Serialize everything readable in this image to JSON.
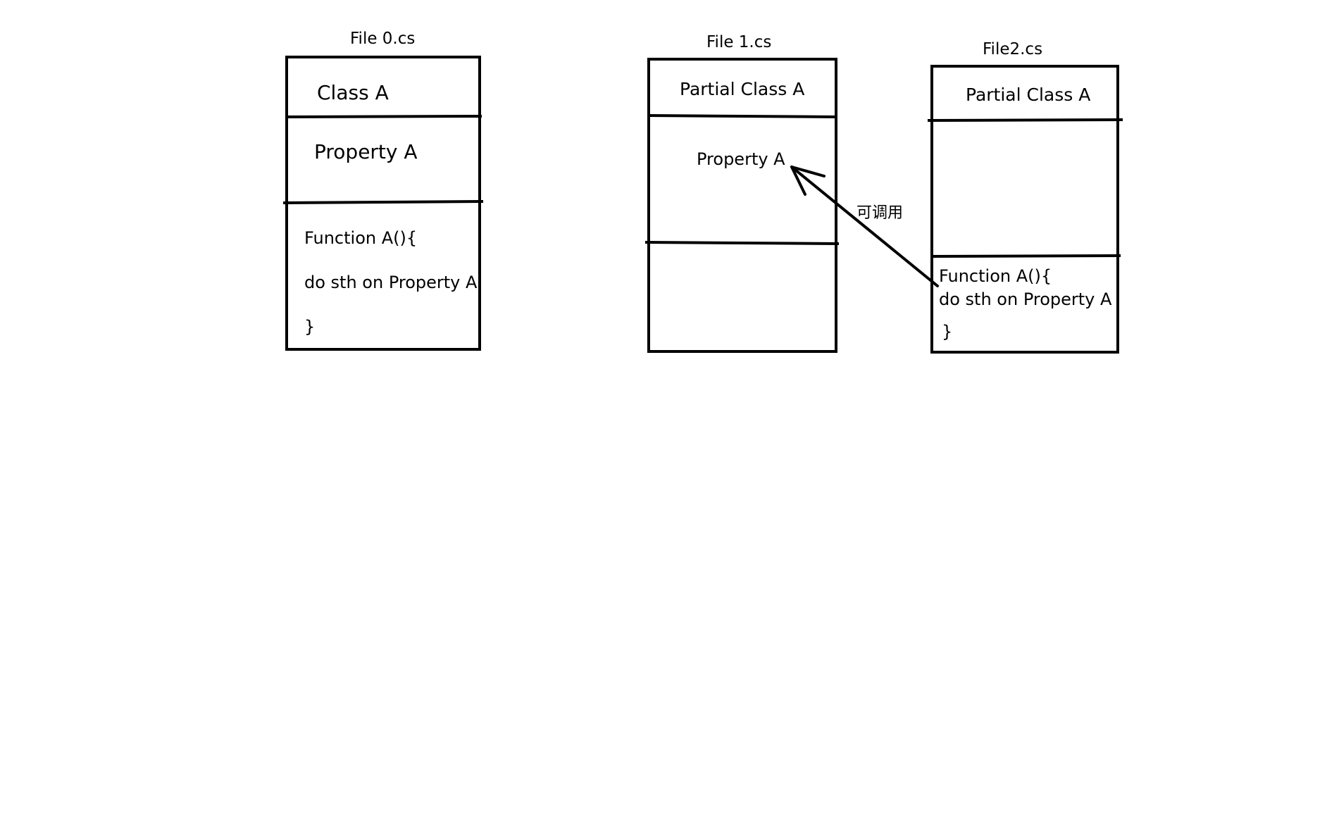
{
  "diagram": {
    "colors": {
      "stroke": "#000000",
      "background": "#ffffff",
      "text": "#000000"
    },
    "files": [
      {
        "label": "File 0.cs",
        "header": "Class A",
        "property": "Property A",
        "function_lines": [
          "Function A(){",
          "do sth on Property A",
          "}"
        ]
      },
      {
        "label": "File 1.cs",
        "header": "Partial Class A",
        "property": "Property A",
        "function_lines": []
      },
      {
        "label": "File2.cs",
        "header": "Partial Class A",
        "property": "",
        "function_lines": [
          "Function A(){",
          "do sth on Property A",
          "}"
        ]
      }
    ],
    "arrow": {
      "label": "可调用",
      "from": "File2.cs Function A",
      "to": "File 1.cs Property A"
    }
  }
}
